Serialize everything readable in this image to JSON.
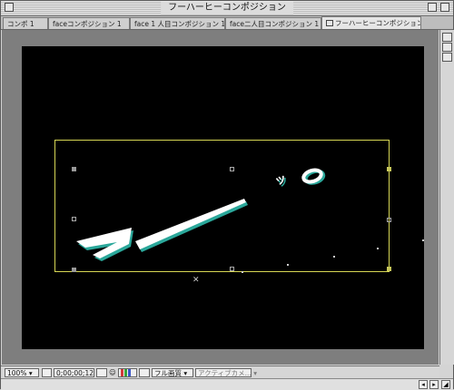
{
  "window": {
    "title": "フーハーヒーコンポジション"
  },
  "tabs": [
    {
      "label": "コンポ 1"
    },
    {
      "label": "faceコンポジション 1"
    },
    {
      "label": "face 1 人目コンポジション 1"
    },
    {
      "label": "face二人目コンポジション 1"
    },
    {
      "label": "フーハーヒーコンポジション"
    }
  ],
  "stage": {
    "text_main": "フー",
    "text_small": "ッ",
    "text_o": "o"
  },
  "bottombar": {
    "zoom": "100%",
    "timecode": "0;00;00;12",
    "quality": "フル画質",
    "camera": "アクティブカメ..."
  },
  "colors": {
    "stage": "#000000",
    "bbox": "#d6d654",
    "text_fill": "#ffffff",
    "text_shadow": "#2aa79a"
  }
}
